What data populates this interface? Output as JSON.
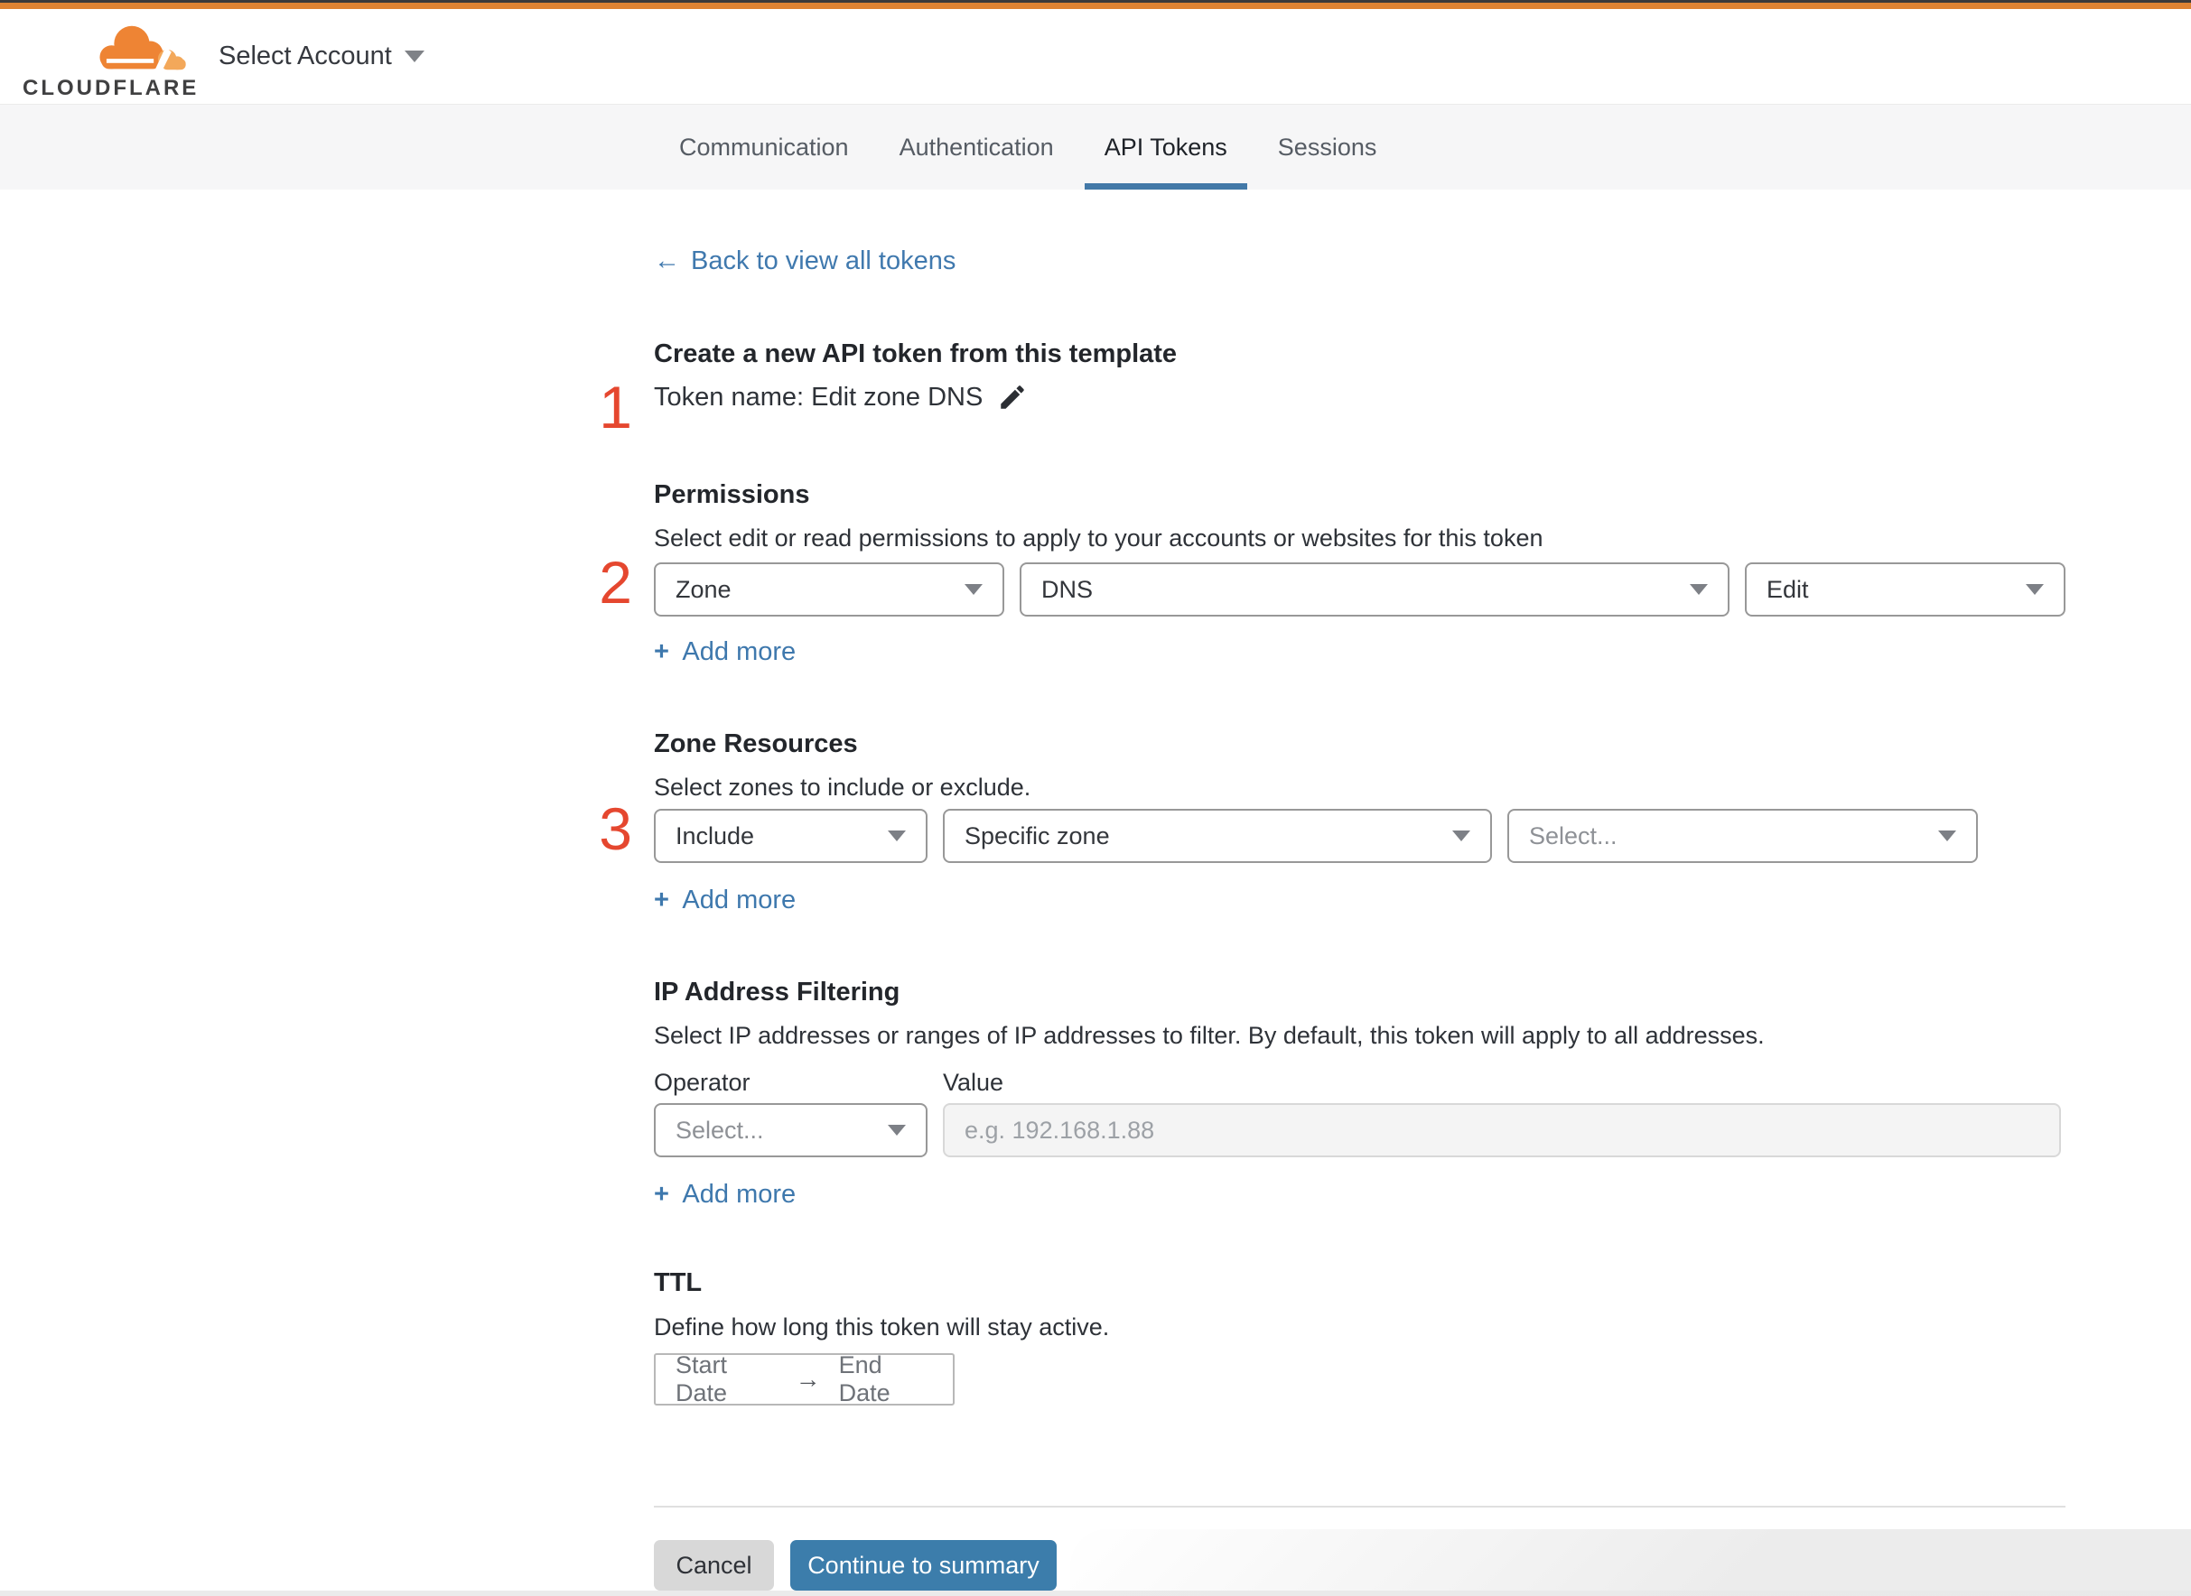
{
  "header": {
    "logo_text": "CLOUDFLARE",
    "account_selector_label": "Select Account"
  },
  "tabs": {
    "items": [
      {
        "label": "Communication",
        "active": false
      },
      {
        "label": "Authentication",
        "active": false
      },
      {
        "label": "API Tokens",
        "active": true
      },
      {
        "label": "Sessions",
        "active": false
      }
    ]
  },
  "page": {
    "back_arrow": "←",
    "back_label": "Back to view all tokens",
    "title": "Create a new API token from this template",
    "token_name_line": "Token name: Edit zone DNS"
  },
  "annotations": {
    "step1": "1",
    "step2": "2",
    "step3": "3"
  },
  "sections": {
    "permissions": {
      "heading": "Permissions",
      "description": "Select edit or read permissions to apply to your accounts or websites for this token",
      "dropdowns": [
        {
          "value": "Zone"
        },
        {
          "value": "DNS"
        },
        {
          "value": "Edit"
        }
      ],
      "add_more_plus": "+",
      "add_more": "Add more"
    },
    "zone_resources": {
      "heading": "Zone Resources",
      "description": "Select zones to include or exclude.",
      "dropdowns": [
        {
          "value": "Include"
        },
        {
          "value": "Specific zone"
        },
        {
          "value": "Select...",
          "is_placeholder": true
        }
      ],
      "add_more_plus": "+",
      "add_more": "Add more"
    },
    "ip_filtering": {
      "heading": "IP Address Filtering",
      "description": "Select IP addresses or ranges of IP addresses to filter. By default, this token will apply to all addresses.",
      "operator_label": "Operator",
      "value_label": "Value",
      "operator_placeholder": "Select...",
      "value_placeholder": "e.g. 192.168.1.88",
      "add_more_plus": "+",
      "add_more": "Add more"
    },
    "ttl": {
      "heading": "TTL",
      "description": "Define how long this token will stay active.",
      "start_date": "Start Date",
      "range_arrow": "→",
      "end_date": "End Date"
    }
  },
  "footer": {
    "cancel_label": "Cancel",
    "continue_label": "Continue to summary"
  },
  "colors": {
    "accent_orange": "#dd8333",
    "annotation_red": "#e5472f",
    "link_blue": "#3e78ad",
    "primary_button_blue": "#3c7dab",
    "active_tab_underline": "#4379a8",
    "tab_band_bg": "#f6f6f7"
  }
}
